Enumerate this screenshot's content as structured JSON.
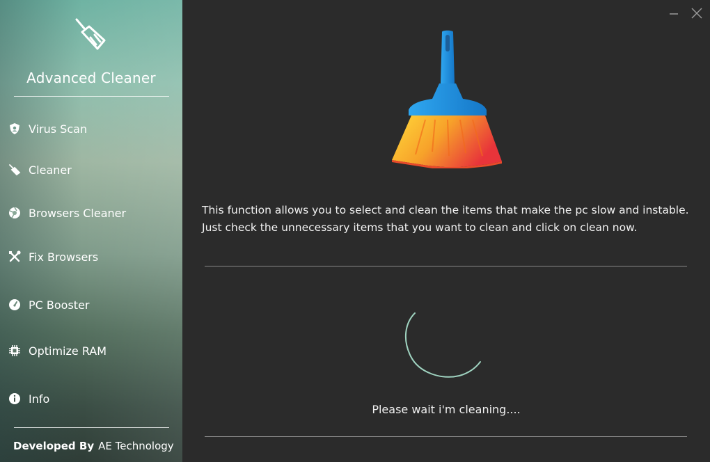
{
  "app": {
    "title": "Advanced Cleaner",
    "logo_icon": "broom-icon"
  },
  "sidebar": {
    "items": [
      {
        "label": "Virus Scan",
        "icon": "shield-icon"
      },
      {
        "label": "Cleaner",
        "icon": "broom-icon"
      },
      {
        "label": "Browsers Cleaner",
        "icon": "browser-globe-icon"
      },
      {
        "label": "Fix Browsers",
        "icon": "tools-icon"
      },
      {
        "label": "PC Booster",
        "icon": "speedometer-icon"
      },
      {
        "label": "Optimize RAM",
        "icon": "ram-chip-icon"
      },
      {
        "label": "Info",
        "icon": "info-icon"
      }
    ],
    "footer": {
      "prefix": "Developed By",
      "company": "AE Technology"
    }
  },
  "window_controls": {
    "minimize_icon": "minimize-icon",
    "close_icon": "close-icon"
  },
  "main": {
    "hero_icon": "broom-icon",
    "description": "This function allows you to select and clean the items that make the pc slow and instable. Just check the unnecessary items that you want to clean and click on clean now.",
    "status_text": "Please wait i'm cleaning....",
    "spinner_icon": "loading-spinner-icon"
  },
  "colors": {
    "background": "#2b2b2b",
    "text": "#ffffff",
    "spinner": "#9fd3c0",
    "broom_handle": "#1e88d8",
    "broom_bristles_start": "#ffd233",
    "broom_bristles_end": "#e8343a"
  }
}
